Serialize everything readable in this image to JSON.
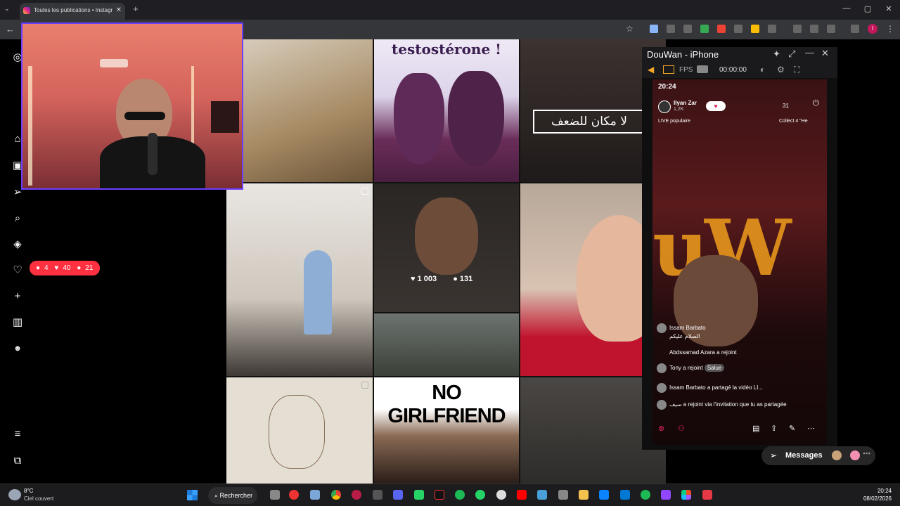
{
  "browser": {
    "tab_title": "Toutes les publications • Instagr",
    "tab_close": "✕",
    "new_tab": "+",
    "win_min": "—",
    "win_max": "▢",
    "win_close": "✕",
    "back": "←",
    "profile_initial": "I"
  },
  "notifications": {
    "comments": "4",
    "likes": "40",
    "follows": "21"
  },
  "grid": {
    "tile2_text": "testostérone !",
    "tile3_text": "لا مكان للضعف",
    "tile5_likes": "1 003",
    "tile5_comments": "131",
    "tile8_text": "NO GIRLFRIEND"
  },
  "phone": {
    "window_title": "DouWan - iPhone",
    "fps_label": "FPS",
    "timer": "00:00:00",
    "clock": "20:24",
    "streamer_name": "Ilyan Zar",
    "streamer_followers": "1,2K",
    "live_badge": "LIVE populaire",
    "collect_label": "Collect 4 \"He",
    "viewers": "31",
    "comments": [
      {
        "user": "Issam Barbato",
        "text": "السلام عليكم"
      },
      {
        "user": "Abdssamad Azara",
        "text": "a rejoint"
      },
      {
        "user": "Tony",
        "text": "a rejoint"
      },
      {
        "user": "Issam Barbato",
        "text": "a partagé la vidéo LI..."
      },
      {
        "user": "سيف",
        "text": "a rejoint via l'invitation que tu as partagée"
      }
    ],
    "salue": "Salue"
  },
  "messages_label": "Messages",
  "taskbar": {
    "weather_temp": "8°C",
    "weather_desc": "Ciel couvert",
    "search_label": "Rechercher",
    "time": "20:24",
    "date": "08/02/2026"
  }
}
